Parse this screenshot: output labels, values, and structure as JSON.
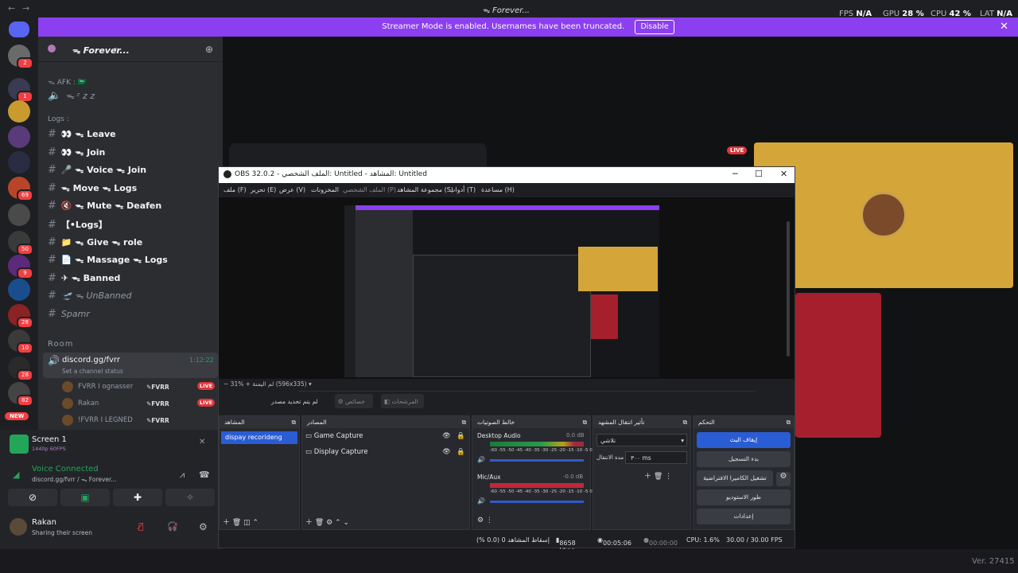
{
  "titlebar": {
    "title": "ᯓ Forever...",
    "nav_back": "←",
    "nav_forward": "→",
    "stats": [
      {
        "label": "FPS",
        "value": "N/A"
      },
      {
        "label": "GPU",
        "value": "28 %"
      },
      {
        "label": "CPU",
        "value": "42 %"
      },
      {
        "label": "LAT",
        "value": "N/A"
      }
    ]
  },
  "banner": {
    "text": "Streamer Mode is enabled. Usernames have been truncated.",
    "button": "Disable",
    "close": "✕"
  },
  "servers": [
    {
      "badge": "2",
      "color": "#6a6a6a"
    },
    {
      "badge": "1",
      "color": "#3a3a52"
    },
    {
      "badge": "",
      "color": "#c99a2e"
    },
    {
      "badge": "",
      "color": "#5a3a7a"
    },
    {
      "badge": "",
      "color": "#2a2c44"
    },
    {
      "badge": "69",
      "color": "#b8452a"
    },
    {
      "badge": "",
      "color": "#4a4a4a"
    },
    {
      "badge": "50",
      "color": "#3a3a3a"
    },
    {
      "badge": "9",
      "color": "#5b2a7a"
    },
    {
      "badge": "",
      "color": "#1a4d8c"
    },
    {
      "badge": "28",
      "color": "#8a2323"
    },
    {
      "badge": "10",
      "color": "#3a3a3a"
    },
    {
      "badge": "28",
      "color": "#2a2a2a"
    },
    {
      "badge": "82",
      "color": "#444"
    }
  ],
  "server_new": "NEW",
  "channels": {
    "server_name": "ᯓ Forever...",
    "afk_category": "ᯓ AFK : 🇸🇦",
    "afk_channel": "ᯓ ᶻ z z",
    "logs_category": "Logs :",
    "items": [
      {
        "icon": "#",
        "name": "👀 ᯓ Leave"
      },
      {
        "icon": "#",
        "name": "👀 ᯓ Join"
      },
      {
        "icon": "#",
        "name": "🎤 ᯓ Voice ᯓ Join"
      },
      {
        "icon": "#",
        "name": "ᯓ Move ᯓ Logs"
      },
      {
        "icon": "#",
        "name": "🔇 ᯓ Mute ᯓ Deafen"
      },
      {
        "icon": "#",
        "name": "【•Logs】"
      },
      {
        "icon": "#",
        "name": "📁 ᯓ Give ᯓ role"
      },
      {
        "icon": "#",
        "name": "📄 ᯓ Massage ᯓ Logs"
      },
      {
        "icon": "#",
        "name": "✈ ᯓ Banned"
      },
      {
        "icon": "#",
        "name": "🛫 ᯓ UnBanned"
      },
      {
        "icon": "#",
        "name": "Spamr"
      }
    ],
    "room_category": "Room",
    "voice_channel": "discord.gg/fvrr",
    "voice_timer": "1:12:22",
    "voice_status": "Set a channel status",
    "voice_users": [
      {
        "name": "FVRR I ognasser",
        "tag": "FVRR",
        "live": "LIVE"
      },
      {
        "name": "Rakan",
        "tag": "FVRR",
        "live": "LIVE"
      },
      {
        "name": "!FVRR I LEGNED",
        "tag": "FVRR",
        "live": ""
      }
    ]
  },
  "panel": {
    "screen_name": "Screen 1",
    "screen_info": "1440p 60FPS",
    "voice_connected": "Voice Connected",
    "voice_path": "discord.gg/fvrr / ᯓ Forever...",
    "user_name": "Rakan",
    "user_status": "Sharing their screen"
  },
  "live_badge": "LIVE",
  "obs": {
    "title": "OBS 32.0.2 - الملف الشخصي: Untitled - المشاهد: Untitled",
    "menu": [
      "ملف (F)",
      "تحرير (E)",
      "عرض (V)",
      "المخزونات",
      "الملف الشخصي (P)",
      "مجموعة المشاهد (S)",
      "أدوات (T)",
      "مساعدة (H)"
    ],
    "zoom": "31%",
    "size": "لم اليمنة (596x335)",
    "no_source": "لم يتم تحديد مصدر",
    "props": "خصائص",
    "filters": "المرشحات",
    "scenes_title": "المشاهد",
    "scene": "dispay recorideng",
    "sources_title": "المصادر",
    "sources": [
      "Game Capture",
      "Display Capture"
    ],
    "mixer_title": "خالط الصوتيات",
    "mixer": [
      {
        "name": "Desktop Audio",
        "db": "0.0 dB"
      },
      {
        "name": "Mic/Aux",
        "db": "-0.0 dB"
      }
    ],
    "meter_ticks": "-60 -55 -50 -45 -40 -35 -30 -25 -20 -15 -10 -5 0",
    "trans_title": "تأثير انتقال المشهد",
    "transition": "تلاشي",
    "duration_label": "مدة الانتقال",
    "duration": "٣٠٠ ms",
    "controls_title": "التحكم",
    "controls": [
      "إيقاف البث",
      "بدء التسجيل",
      "تشغيل الكاميرا الافتراضية",
      "طور الاستوديو",
      "إعدادات"
    ],
    "status": {
      "dropped": "إسقاط المشاهد 0 (0.0 %)",
      "kbps": "8658 kbps",
      "stream_time": "00:05:06",
      "rec_time": "00:00:00",
      "cpu": "CPU: 1.6%",
      "fps": "30.00 / 30.00 FPS"
    }
  },
  "version": "Ver. 27415"
}
